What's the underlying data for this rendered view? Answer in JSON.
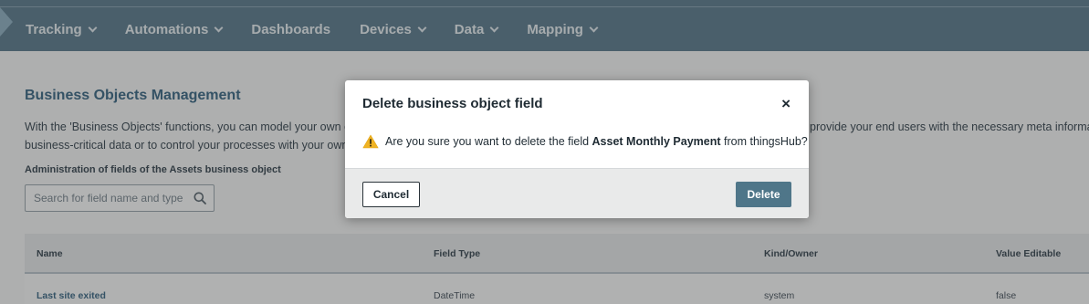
{
  "nav": {
    "items": [
      {
        "label": "Tracking",
        "dropdown": true
      },
      {
        "label": "Automations",
        "dropdown": true
      },
      {
        "label": "Dashboards",
        "dropdown": false
      },
      {
        "label": "Devices",
        "dropdown": true
      },
      {
        "label": "Data",
        "dropdown": true
      },
      {
        "label": "Mapping",
        "dropdown": true
      }
    ]
  },
  "page": {
    "title": "Business Objects Management",
    "description_line1_left": "With the 'Business Objects' functions, you can model your own cu",
    "description_line1_right": "provide your end users with the necessary meta informat",
    "description_line2_left": "business-critical data or to control your processes with your own",
    "admin_label": "Administration of fields of the Assets business object",
    "search_placeholder": "Search for field name and type"
  },
  "table": {
    "headers": [
      "Name",
      "Field Type",
      "Kind/Owner",
      "Value Editable"
    ],
    "rows": [
      {
        "name": "Last site exited",
        "field_type": "DateTime",
        "kind_owner": "system",
        "value_editable": "false"
      }
    ]
  },
  "modal": {
    "title": "Delete business object field",
    "close_label": "×",
    "message_prefix": "Are you sure you want to delete the field ",
    "field_name": "Asset Monthly Payment",
    "message_suffix": " from thingsHub?",
    "cancel_label": "Cancel",
    "delete_label": "Delete"
  },
  "colors": {
    "navbar": "#5f7e8f",
    "title_accent": "#3e6a86",
    "delete_button": "#4f7689",
    "warning": "#f0b323"
  },
  "icons": {
    "search": "search-icon",
    "warning": "warning-icon",
    "close": "close-icon",
    "chevron": "chevron-down-icon"
  }
}
